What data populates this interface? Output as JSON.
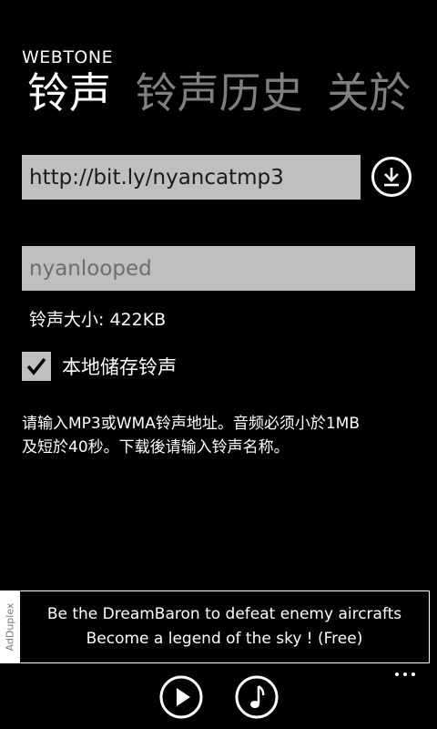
{
  "app_title": "WEBTONE",
  "pivot": {
    "tabs": [
      {
        "label": "铃声",
        "active": true
      },
      {
        "label": "铃声历史",
        "active": false
      },
      {
        "label": "关於",
        "active": false
      }
    ]
  },
  "form": {
    "url_value": "http://bit.ly/nyancatmp3",
    "name_value": "nyanlooped",
    "size_label": "铃声大小: 422KB",
    "save_local_label": "本地储存铃声",
    "save_local_checked": true,
    "info_text_line1": "请输入MP3或WMA铃声地址。音频必须小於1MB",
    "info_text_line2": "及短於40秒。下载後请输入铃声名称。"
  },
  "ad": {
    "provider": "AdDuplex",
    "line1": "Be the DreamBaron to defeat enemy aircrafts",
    "line2": "Become a legend of the sky ! (Free)"
  },
  "appbar": {
    "icons": [
      "play-icon",
      "music-note-icon",
      "more-icon"
    ]
  }
}
